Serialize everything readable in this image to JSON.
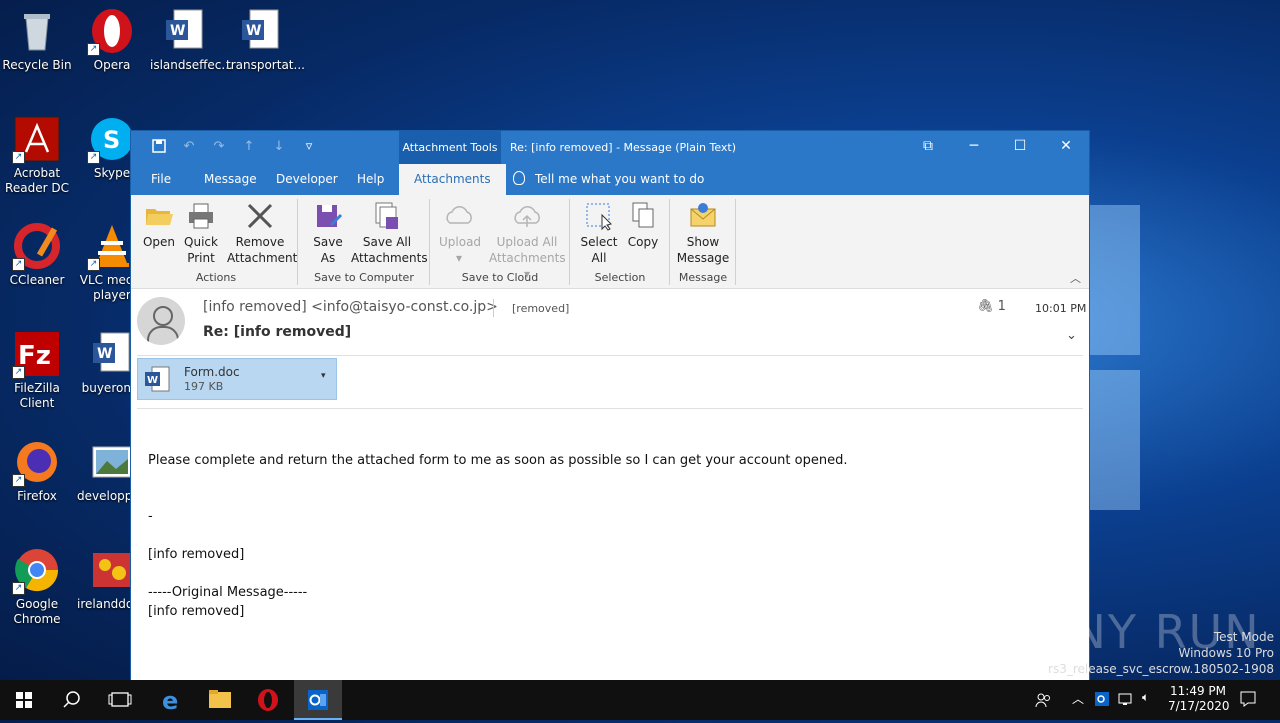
{
  "desktop": {
    "icons": [
      {
        "label": "Recycle Bin"
      },
      {
        "label": "Opera"
      },
      {
        "label": "islandseffec..."
      },
      {
        "label": "transportat..."
      },
      {
        "label": "Acrobat Reader DC"
      },
      {
        "label": "Skype"
      },
      {
        "label": "CCleaner"
      },
      {
        "label": "VLC media player"
      },
      {
        "label": "FileZilla Client"
      },
      {
        "label": "buyeron..."
      },
      {
        "label": "Firefox"
      },
      {
        "label": "developpl..."
      },
      {
        "label": "Google Chrome"
      },
      {
        "label": "irelanddoi..."
      }
    ]
  },
  "window": {
    "context_tab": "Attachment Tools",
    "title": "Re: [info removed]  -  Message (Plain Text)",
    "controls": {
      "restore_alt": "⧉",
      "minimize": "─",
      "maximize": "☐",
      "close": "✕"
    }
  },
  "tabs": [
    {
      "label": "File"
    },
    {
      "label": "Message"
    },
    {
      "label": "Developer"
    },
    {
      "label": "Help"
    },
    {
      "label": "Attachments"
    }
  ],
  "tell_me": "Tell me what you want to do",
  "ribbon": {
    "groups": [
      {
        "name": "Actions",
        "buttons": [
          {
            "label": "Open"
          },
          {
            "label": "Quick Print"
          },
          {
            "label": "Remove Attachment"
          }
        ]
      },
      {
        "name": "Save to Computer",
        "buttons": [
          {
            "label": "Save As"
          },
          {
            "label": "Save All Attachments"
          }
        ]
      },
      {
        "name": "Save to Cloud",
        "buttons": [
          {
            "label": "Upload"
          },
          {
            "label": "Upload All Attachments"
          }
        ]
      },
      {
        "name": "Selection",
        "buttons": [
          {
            "label": "Select All"
          },
          {
            "label": "Copy"
          }
        ]
      },
      {
        "name": "Message",
        "buttons": [
          {
            "label": "Show Message"
          }
        ]
      }
    ]
  },
  "message": {
    "sender": "[info removed] <info@taisyo-const.co.jp>",
    "to": "[removed]",
    "attachment_count": "1",
    "time": "10:01 PM",
    "subject": "Re: [info removed]",
    "attachment": {
      "name": "Form.doc",
      "size": "197 KB"
    },
    "body": [
      "Please complete and return the attached form to me as soon as possible so I can get your account opened.",
      "-",
      "[info removed]",
      "-----Original Message-----",
      "[info removed]"
    ]
  },
  "watermark": {
    "line1": "Test Mode",
    "line2": "Windows 10 Pro",
    "line3": "rs3_release_svc_escrow.180502-1908",
    "brand": "ANY RUN"
  },
  "taskbar": {
    "time": "11:49 PM",
    "date": "7/17/2020"
  },
  "colors": {
    "outlook_blue": "#2b78c9",
    "context_tab": "#1a5fae",
    "attachment_highlight": "#b9d7f0"
  }
}
